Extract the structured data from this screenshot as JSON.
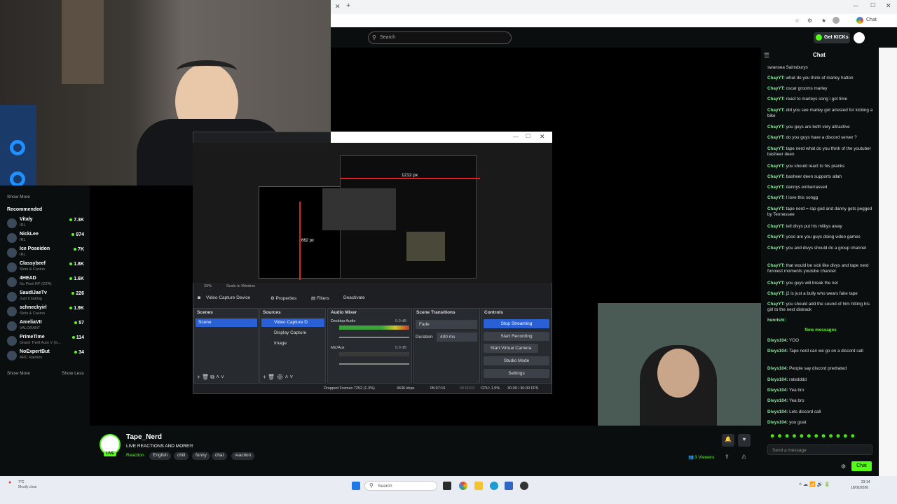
{
  "browser": {
    "chat_tab_label": "Chat"
  },
  "header": {
    "search_placeholder": "Search",
    "get_kicks": "Get KICKs"
  },
  "sidebar": {
    "show_more_top": "Show More",
    "recommended_title": "Recommended",
    "items": [
      {
        "name": "Vitaly",
        "category": "IRL",
        "count": "7.3K"
      },
      {
        "name": "NickLee",
        "category": "IRL",
        "count": "974"
      },
      {
        "name": "Ice Poseidon",
        "category": "IRL",
        "count": "7K"
      },
      {
        "name": "Classybeef",
        "category": "Slots & Casino",
        "count": "1.8K"
      },
      {
        "name": "4HEAD",
        "category": "No Pixel RP (GTA)",
        "count": "1.6K"
      },
      {
        "name": "SaudiJaeTv",
        "category": "Just Chatting",
        "count": "226"
      },
      {
        "name": "schneckyirl",
        "category": "Slots & Casino",
        "count": "1.9K"
      },
      {
        "name": "AmeliaVII",
        "category": "VALORANT",
        "count": "57"
      },
      {
        "name": "PrimeTime",
        "category": "Grand Theft Auto V (G...",
        "count": "114"
      },
      {
        "name": "NoExpertBut",
        "category": "ARC Raiders",
        "count": "34"
      }
    ],
    "show_more": "Show More",
    "show_less": "Show Less"
  },
  "obs": {
    "preview_label_w": "1212 px",
    "preview_label_h": "662 px",
    "zoom": "33%",
    "scale_label": "Scale to Window",
    "source_toolbar": {
      "device": "Video Capture Device",
      "properties": "Properties",
      "filters": "Filters",
      "deactivate": "Deactivate"
    },
    "scenes": {
      "title": "Scenes",
      "items": [
        "Scene"
      ]
    },
    "sources": {
      "title": "Sources",
      "items": [
        "Video Capture D",
        "Display Capture",
        "Image"
      ]
    },
    "mixer": {
      "title": "Audio Mixer",
      "channels": [
        {
          "name": "Desktop Audio",
          "db": "0.0 dB"
        },
        {
          "name": "Mic/Aux",
          "db": "0.0 dB"
        }
      ]
    },
    "transitions": {
      "title": "Scene Transitions",
      "type": "Fade",
      "duration_label": "Duration",
      "duration": "400 ms"
    },
    "controls": {
      "title": "Controls",
      "buttons": [
        "Stop Streaming",
        "Start Recording",
        "Start Virtual Camera",
        "Studio Mode",
        "Settings"
      ]
    },
    "status": {
      "dropped": "Dropped Frames 7252 (1.3%)",
      "kbps": "4636 kbps",
      "stream_time": "05:07:16",
      "rec_time": "00:00:00",
      "cpu": "CPU: 1.5%",
      "fps": "30.00 / 30.00 FPS"
    }
  },
  "chat": {
    "title": "Chat",
    "messages": [
      {
        "user": "",
        "text": "swansea Sainsburys"
      },
      {
        "user": "ChayYT:",
        "text": "what do you think of marley hatton"
      },
      {
        "user": "ChayYT:",
        "text": "oscar grooms marley"
      },
      {
        "user": "ChayYT:",
        "text": "react to marleys song i got time"
      },
      {
        "user": "ChayYT:",
        "text": "did you see marley got arrested for kicking a bike"
      },
      {
        "user": "ChayYT:",
        "text": "you guys are both very attractive"
      },
      {
        "user": "ChayYT:",
        "text": "do you guys have a discord server ?"
      },
      {
        "user": "ChayYT:",
        "text": "tape nerd what do you think of the youtuber basheer deen"
      },
      {
        "user": "ChayYT:",
        "text": "you should react to his pranks"
      },
      {
        "user": "ChayYT:",
        "text": "basheer deen supports allah"
      },
      {
        "user": "ChayYT:",
        "text": "dannys embarrassed"
      },
      {
        "user": "ChayYT:",
        "text": "I love this songg"
      },
      {
        "user": "ChayYT:",
        "text": "tape nerd = rap god and danny gets pegged by Tennessee"
      },
      {
        "user": "ChayYT:",
        "text": "tell divys put his milkys away"
      },
      {
        "user": "ChayYT:",
        "text": "yooo are you guys doing video games"
      },
      {
        "user": "ChayYT:",
        "text": "you and divys should do a group channel"
      },
      {
        "user": "ChayYT:",
        "text": "that would be sick like divys and tape nerd funniest moments youtube channel"
      },
      {
        "user": "ChayYT:",
        "text": "you guys will break the net"
      },
      {
        "user": "ChayYT:",
        "text": "j2 is just a bully who wears fake tape"
      },
      {
        "user": "ChayYT:",
        "text": "you should add the sound of him hitting his girl to the next distrack"
      },
      {
        "user": "henrishi:",
        "text": ""
      }
    ],
    "new_messages_label": "New messages",
    "new_messages": [
      {
        "user": "Divys104:",
        "text": "YOO"
      },
      {
        "user": "Divys104:",
        "text": "Tape nerd can we go on a discord call"
      },
      {
        "user": "Divys104:",
        "text": "People say discord predrated"
      },
      {
        "user": "Divys104:",
        "text": "ratedddd"
      },
      {
        "user": "Divys104:",
        "text": "Yea bro"
      },
      {
        "user": "Divys104:",
        "text": "Yea bro"
      },
      {
        "user": "Divys104:",
        "text": "Lets discord call"
      },
      {
        "user": "Divys104:",
        "text": "you goat"
      }
    ],
    "input_placeholder": "Send a message",
    "send_button": "Chat"
  },
  "stream": {
    "name": "Tape_Nerd",
    "title": "LIVE REACTIONS AND MORE!!!",
    "category": "Reaction",
    "tags": [
      "English",
      "chill",
      "funny",
      "chat",
      "reaction"
    ],
    "viewers": "3 Viewers",
    "live_badge": "LIVE"
  },
  "taskbar": {
    "weather_temp": "7°C",
    "weather_desc": "Mostly clear",
    "search": "Search",
    "time": "23:14",
    "date": "18/02/2026"
  }
}
